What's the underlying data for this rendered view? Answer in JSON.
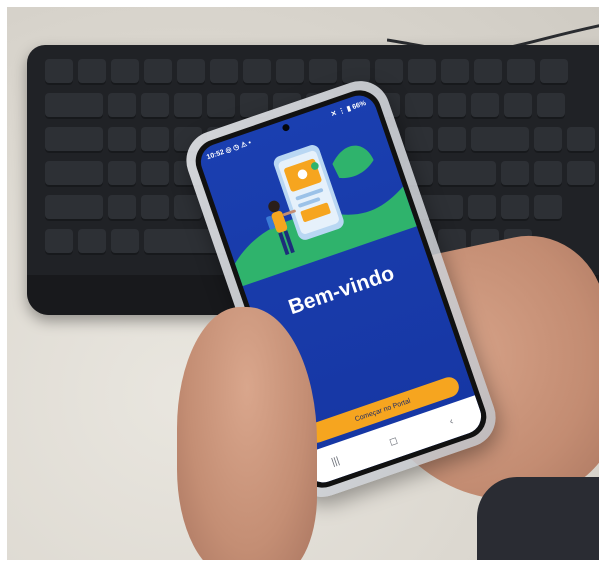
{
  "app": {
    "status": {
      "time": "10:52",
      "left_icons": "◎ ◷ ⚠ •",
      "right_icons": "✕ ⋮ ▮",
      "battery": "66%"
    },
    "title": "Bem-vindo",
    "cta_label": "Começar no Portal",
    "nav": [
      "|||",
      "◻",
      "‹"
    ]
  },
  "icons": [
    "back-icon",
    "home-icon",
    "recents-icon",
    "battery-icon",
    "signal-icon"
  ],
  "colors": {
    "screen_bg": "#1a3fb0",
    "accent_green": "#2fb36c",
    "cta": "#f6a51f"
  }
}
